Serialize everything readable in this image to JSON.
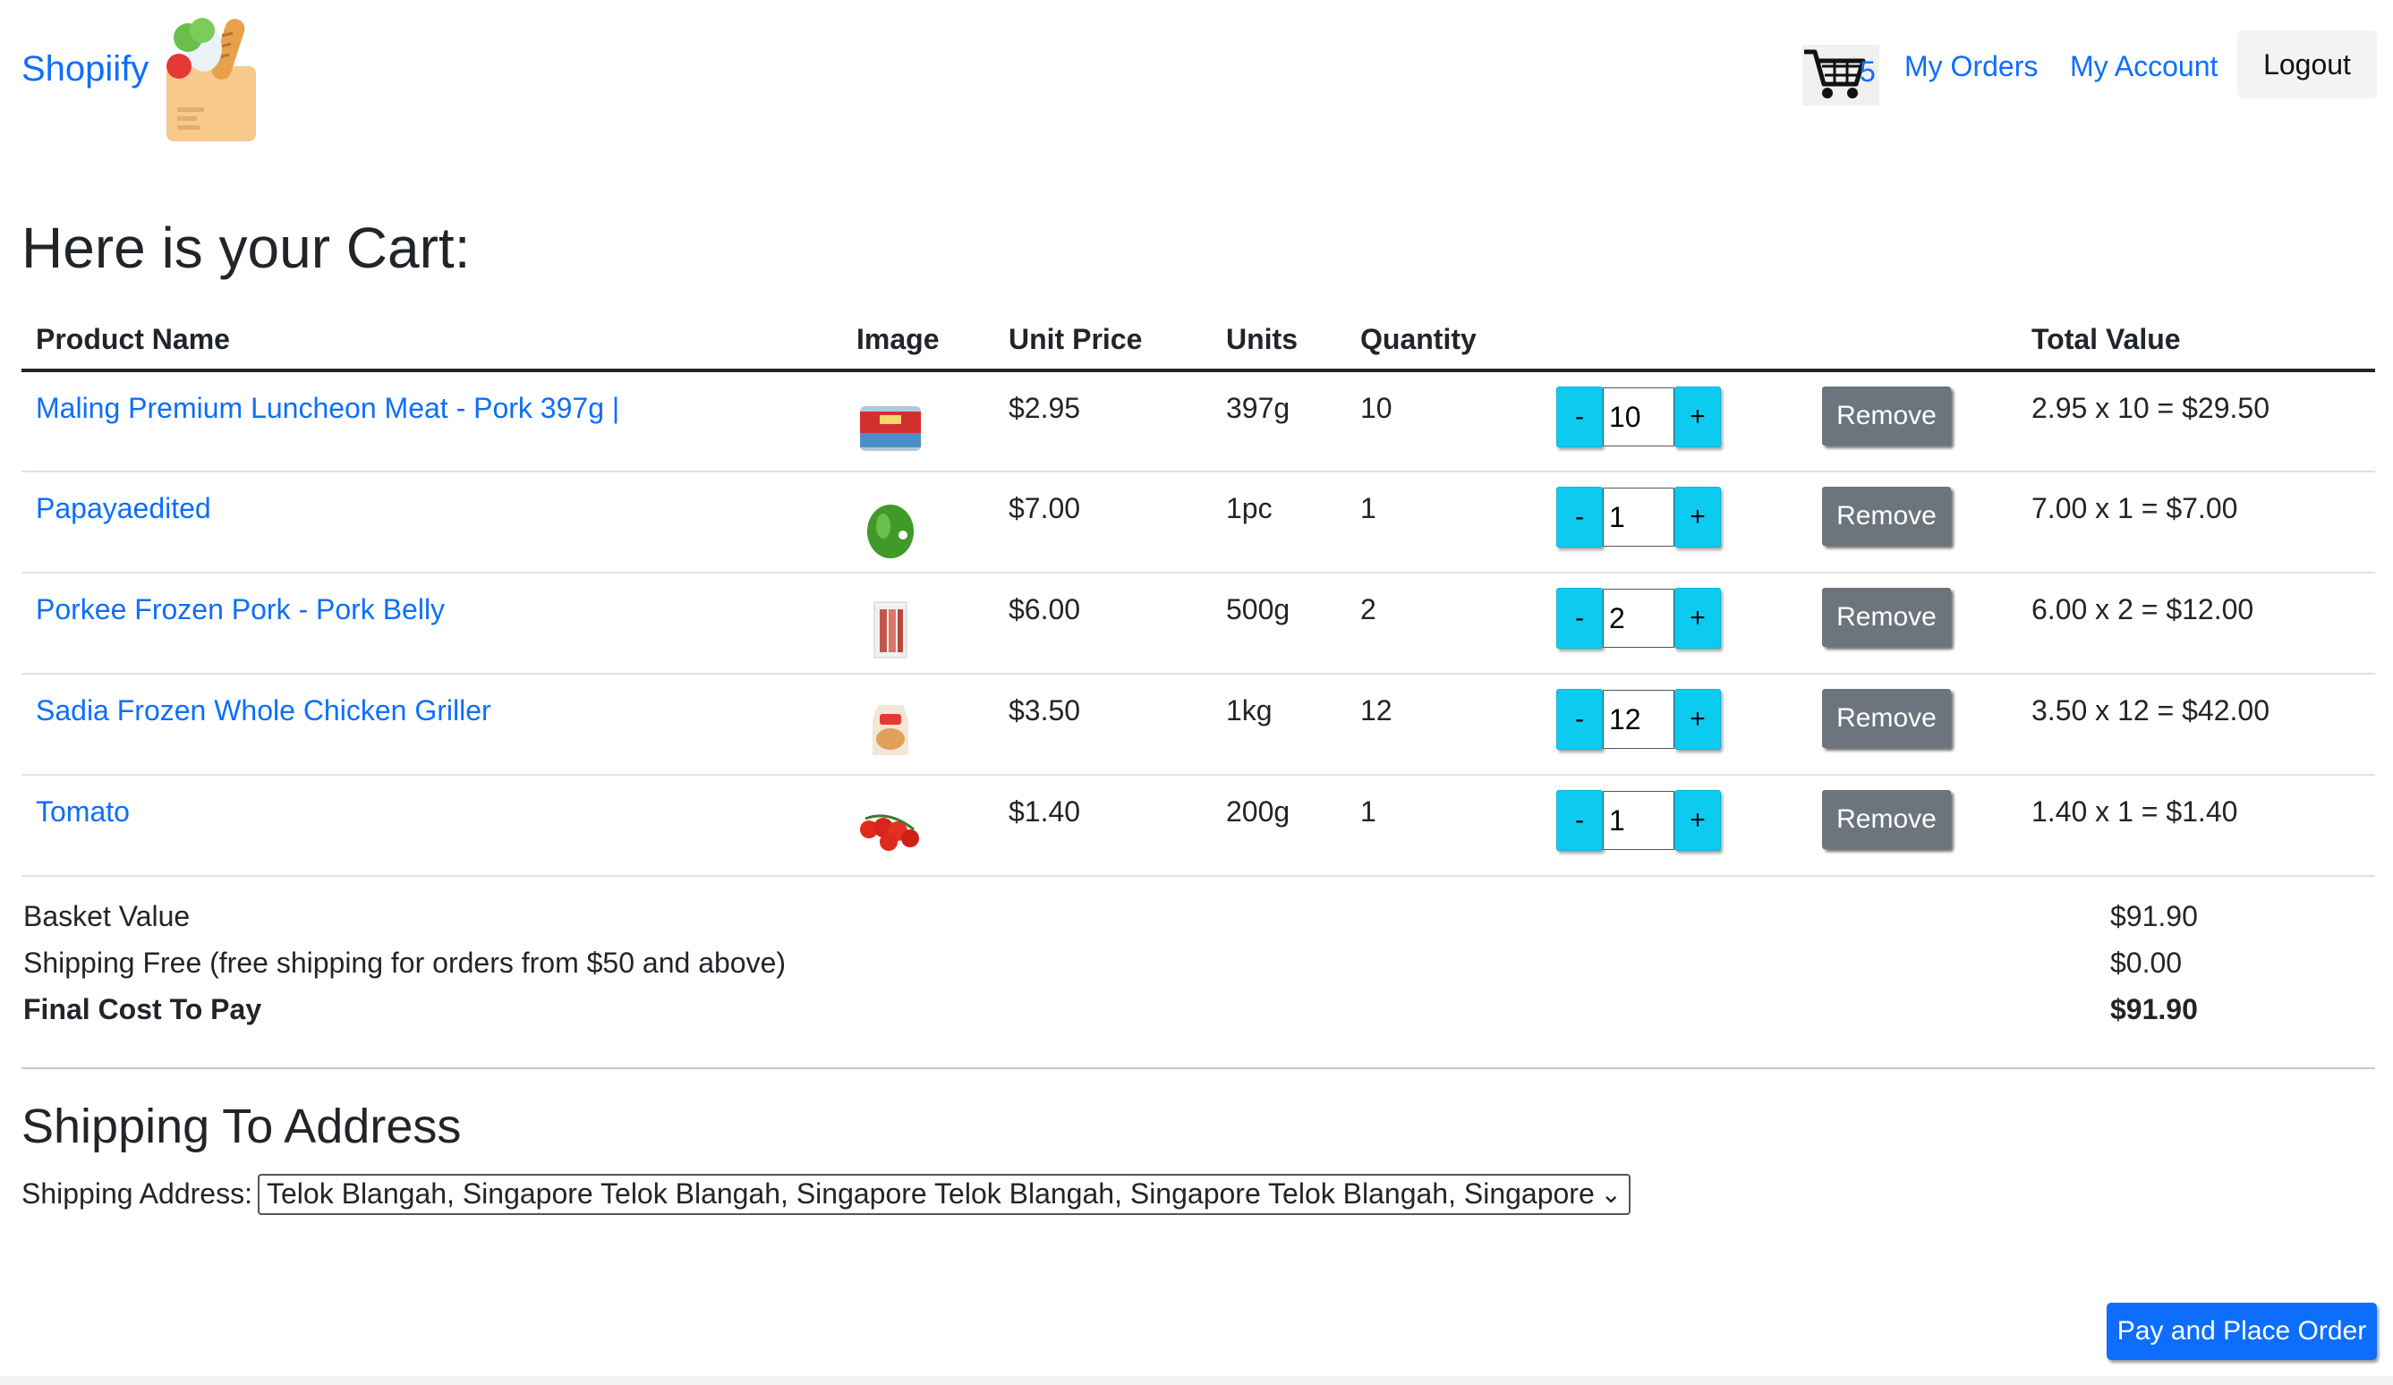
{
  "navbar": {
    "brand": "Shopiify",
    "cart_count": "5",
    "my_orders": "My Orders",
    "my_account": "My Account",
    "logout": "Logout"
  },
  "page_title": "Here is your Cart:",
  "table": {
    "headers": {
      "product_name": "Product Name",
      "image": "Image",
      "unit_price": "Unit Price",
      "units": "Units",
      "quantity": "Quantity",
      "total_value": "Total Value"
    },
    "rows": [
      {
        "name": "Maling Premium Luncheon Meat - Pork 397g |",
        "image": "luncheon-meat-can",
        "price": "$2.95",
        "units": "397g",
        "quantity": "10",
        "input_value": "10",
        "minus": "-",
        "plus": "+",
        "remove": "Remove",
        "total": "2.95 x 10 = $29.50"
      },
      {
        "name": "Papayaedited",
        "image": "papaya",
        "price": "$7.00",
        "units": "1pc",
        "quantity": "1",
        "input_value": "1",
        "minus": "-",
        "plus": "+",
        "remove": "Remove",
        "total": "7.00 x 1 = $7.00"
      },
      {
        "name": "Porkee Frozen Pork - Pork Belly",
        "image": "pork-belly-pack",
        "price": "$6.00",
        "units": "500g",
        "quantity": "2",
        "input_value": "2",
        "minus": "-",
        "plus": "+",
        "remove": "Remove",
        "total": "6.00 x 2 = $12.00"
      },
      {
        "name": "Sadia Frozen Whole Chicken Griller",
        "image": "chicken-bag",
        "price": "$3.50",
        "units": "1kg",
        "quantity": "12",
        "input_value": "12",
        "minus": "-",
        "plus": "+",
        "remove": "Remove",
        "total": "3.50 x 12 = $42.00"
      },
      {
        "name": "Tomato",
        "image": "tomato-vine",
        "price": "$1.40",
        "units": "200g",
        "quantity": "1",
        "input_value": "1",
        "minus": "-",
        "plus": "+",
        "remove": "Remove",
        "total": "1.40 x 1 = $1.40"
      }
    ]
  },
  "summary": {
    "basket_label": "Basket Value",
    "basket_value": "$91.90",
    "shipping_label": "Shipping Free (free shipping for orders from $50 and above)",
    "shipping_value": "$0.00",
    "final_label": "Final Cost To Pay",
    "final_value": "$91.90"
  },
  "shipping": {
    "title": "Shipping To Address",
    "label": "Shipping Address:",
    "selected": "Telok Blangah, Singapore Telok Blangah, Singapore Telok Blangah, Singapore Telok Blangah, Singapore"
  },
  "pay_button": "Pay and Place Order",
  "colors": {
    "link": "#0d6efd",
    "qty_button": "#0dcaf0",
    "remove_button": "#6c757d",
    "pay_button": "#0d6efd"
  }
}
